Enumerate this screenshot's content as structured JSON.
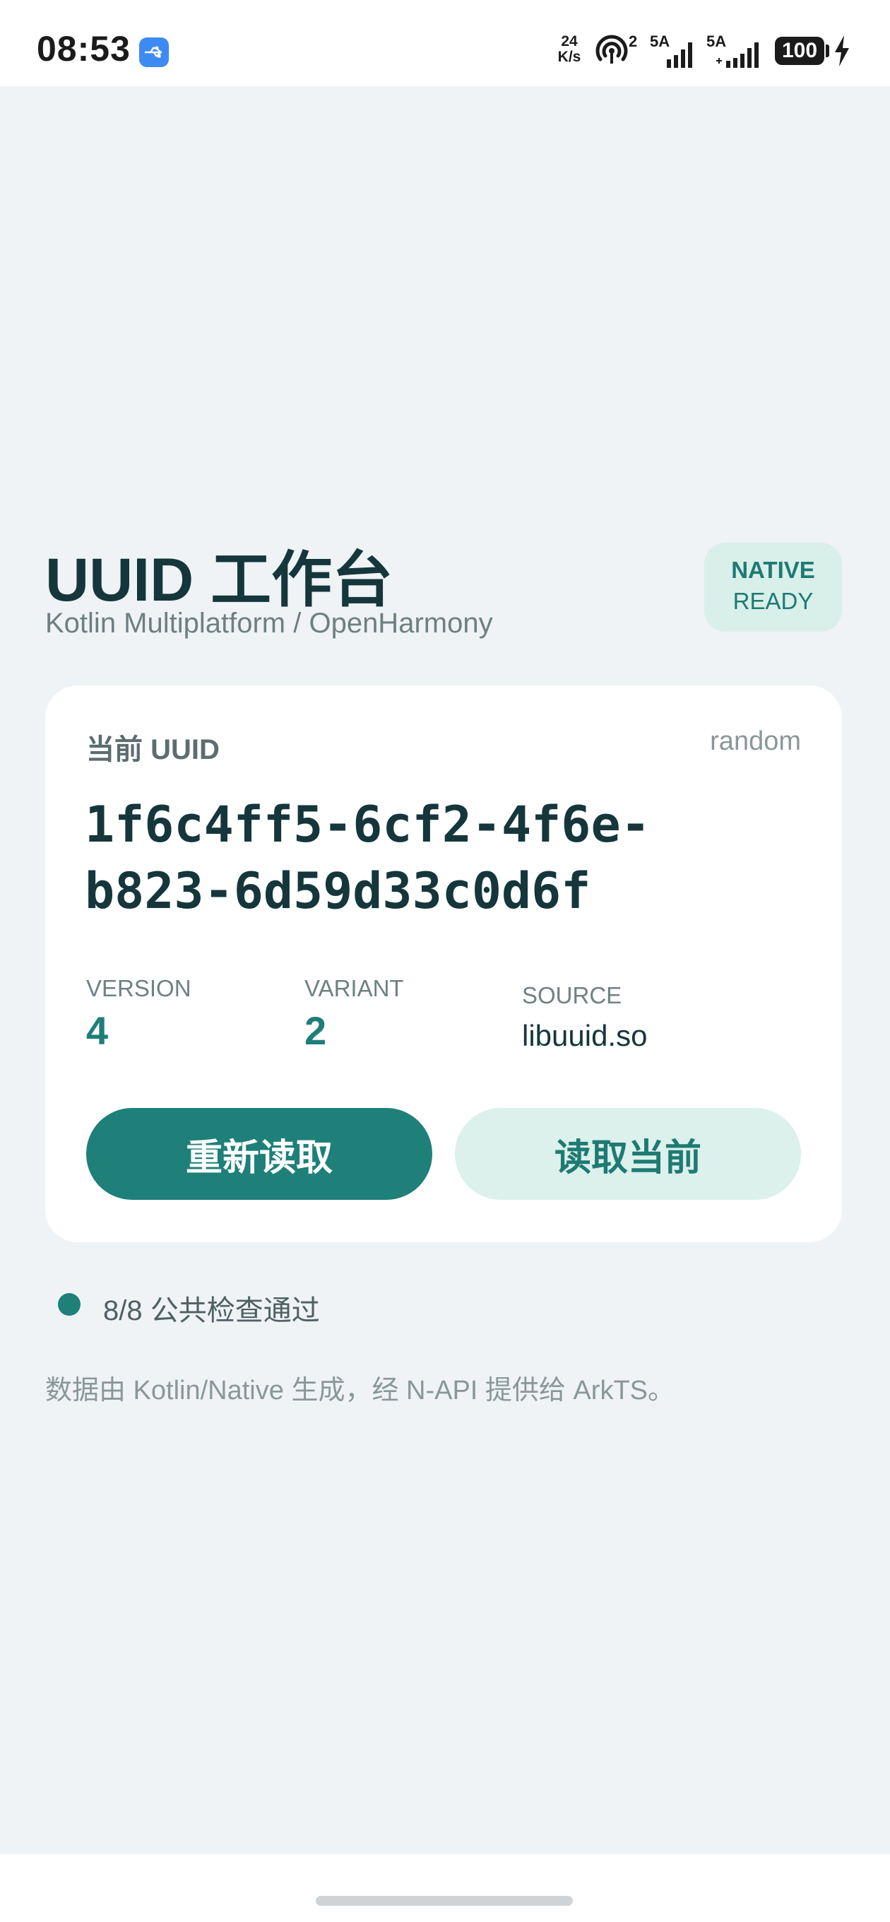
{
  "status_bar": {
    "time": "08:53",
    "net_speed_value": "24",
    "net_speed_unit": "K/s",
    "hotspot_count": "2",
    "signal_1_label": "5A",
    "signal_2_label": "5A",
    "battery": "100",
    "icons": [
      "usb-icon",
      "hotspot-icon",
      "signal-icon",
      "battery-icon",
      "charging-bolt-icon"
    ]
  },
  "header": {
    "title": "UUID 工作台",
    "subtitle": "Kotlin Multiplatform / OpenHarmony",
    "badge_line1": "NATIVE",
    "badge_line2": "READY"
  },
  "card": {
    "label": "当前 UUID",
    "mode": "random",
    "uuid_line1": "1f6c4ff5-6cf2-4f6e-",
    "uuid_line2": "b823-6d59d33c0d6f",
    "meta": [
      {
        "label": "VERSION",
        "value": "4"
      },
      {
        "label": "VARIANT",
        "value": "2"
      },
      {
        "label": "SOURCE",
        "value": "libuuid.so"
      }
    ],
    "primary_button": "重新读取",
    "secondary_button": "读取当前"
  },
  "checks": {
    "text": "8/8 公共检查通过"
  },
  "footnote": "数据由 Kotlin/Native 生成，经 N-API 提供给 ArkTS。",
  "colors": {
    "accent": "#1e8079",
    "accent_soft": "#dcf0ec",
    "background": "#eff3f6",
    "title": "#15363b"
  }
}
